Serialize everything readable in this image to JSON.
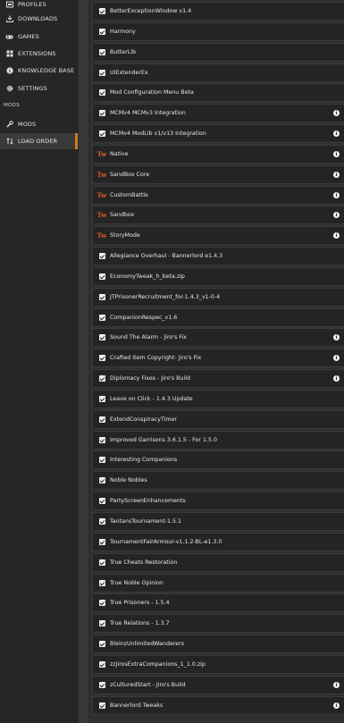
{
  "sidebar": {
    "nav": [
      {
        "label": "PROFILES",
        "icon": "profiles-icon"
      },
      {
        "label": "DOWNLOADS",
        "icon": "download-icon"
      },
      {
        "label": "GAMES",
        "icon": "gamepad-icon"
      },
      {
        "label": "EXTENSIONS",
        "icon": "extensions-icon"
      },
      {
        "label": "KNOWLEDGE BASE",
        "icon": "info-circle-icon"
      },
      {
        "label": "SETTINGS",
        "icon": "gear-icon"
      }
    ],
    "section_mods": "MODS",
    "mods_nav": [
      {
        "label": "MODS",
        "icon": "wrench-icon"
      },
      {
        "label": "LOAD ORDER",
        "icon": "sort-icon",
        "active": true
      }
    ],
    "accent_color": "#d4781c"
  },
  "load_order": [
    {
      "label": "BetterExceptionWindow v1.4",
      "type": "checkbox",
      "info": false
    },
    {
      "label": "Harmony",
      "type": "checkbox",
      "info": false
    },
    {
      "label": "ButterLib",
      "type": "checkbox",
      "info": false
    },
    {
      "label": "UIExtenderEx",
      "type": "checkbox",
      "info": false
    },
    {
      "label": "Mod Configuration Menu Beta",
      "type": "checkbox",
      "info": false
    },
    {
      "label": "MCMv4 MCMv3 Integration",
      "type": "checkbox",
      "info": true
    },
    {
      "label": "MCMv4 ModLib v1/v13 Integration",
      "type": "checkbox",
      "info": true
    },
    {
      "label": "Native",
      "type": "taleworlds",
      "info": true
    },
    {
      "label": "SandBox Core",
      "type": "taleworlds",
      "info": true
    },
    {
      "label": "CustomBattle",
      "type": "taleworlds",
      "info": true
    },
    {
      "label": "Sandbox",
      "type": "taleworlds",
      "info": true
    },
    {
      "label": "StoryMode",
      "type": "taleworlds",
      "info": true
    },
    {
      "label": "Allegiance Overhaul - Bannerlord e1.4.3",
      "type": "checkbox",
      "info": false
    },
    {
      "label": "EconomyTweak_h_beta.zip",
      "type": "checkbox",
      "info": false
    },
    {
      "label": "JTPrisonerRecruitment_for-1.4.3_v1-0-4",
      "type": "checkbox",
      "info": false
    },
    {
      "label": "CompanionRespec_v1.6",
      "type": "checkbox",
      "info": false
    },
    {
      "label": "Sound The Alarm - Jiro's Fix",
      "type": "checkbox",
      "info": true
    },
    {
      "label": "Crafted Item Copyright- Jiro's Fix",
      "type": "checkbox",
      "info": true
    },
    {
      "label": "Diplomacy Fixes - Jiro's Build",
      "type": "checkbox",
      "info": true
    },
    {
      "label": "Leave on Click - 1.4.3 Update",
      "type": "checkbox",
      "info": false
    },
    {
      "label": "ExtendConspiracyTimer",
      "type": "checkbox",
      "info": false
    },
    {
      "label": "Improved Garrisons 3.6.1.5 - For 1.5.0",
      "type": "checkbox",
      "info": false
    },
    {
      "label": "Interesting Companions",
      "type": "checkbox",
      "info": false
    },
    {
      "label": "Noble Nobles",
      "type": "checkbox",
      "info": false
    },
    {
      "label": "PartyScreenEnhancements",
      "type": "checkbox",
      "info": false
    },
    {
      "label": "TantansTournament-1.5.1",
      "type": "checkbox",
      "info": false
    },
    {
      "label": "TournamentFairArmour-v1.1.2-BL-e1.3.0",
      "type": "checkbox",
      "info": false
    },
    {
      "label": "True Cheats Restoration",
      "type": "checkbox",
      "info": false
    },
    {
      "label": "True Noble Opinion",
      "type": "checkbox",
      "info": false
    },
    {
      "label": "True Prisoners - 1.5.4",
      "type": "checkbox",
      "info": false
    },
    {
      "label": "True Relations - 1.3.7",
      "type": "checkbox",
      "info": false
    },
    {
      "label": "BleinzUnlimitedWanderers",
      "type": "checkbox",
      "info": false
    },
    {
      "label": "zzJirosExtraCompanions_1_1.0.zip",
      "type": "checkbox",
      "info": false
    },
    {
      "label": "zCulturedStart - Jiro's Build",
      "type": "checkbox",
      "info": true
    },
    {
      "label": "Bannerlord Tweaks",
      "type": "checkbox",
      "info": true
    }
  ],
  "taleworlds_glyph": "Tw",
  "info_glyph": "i"
}
